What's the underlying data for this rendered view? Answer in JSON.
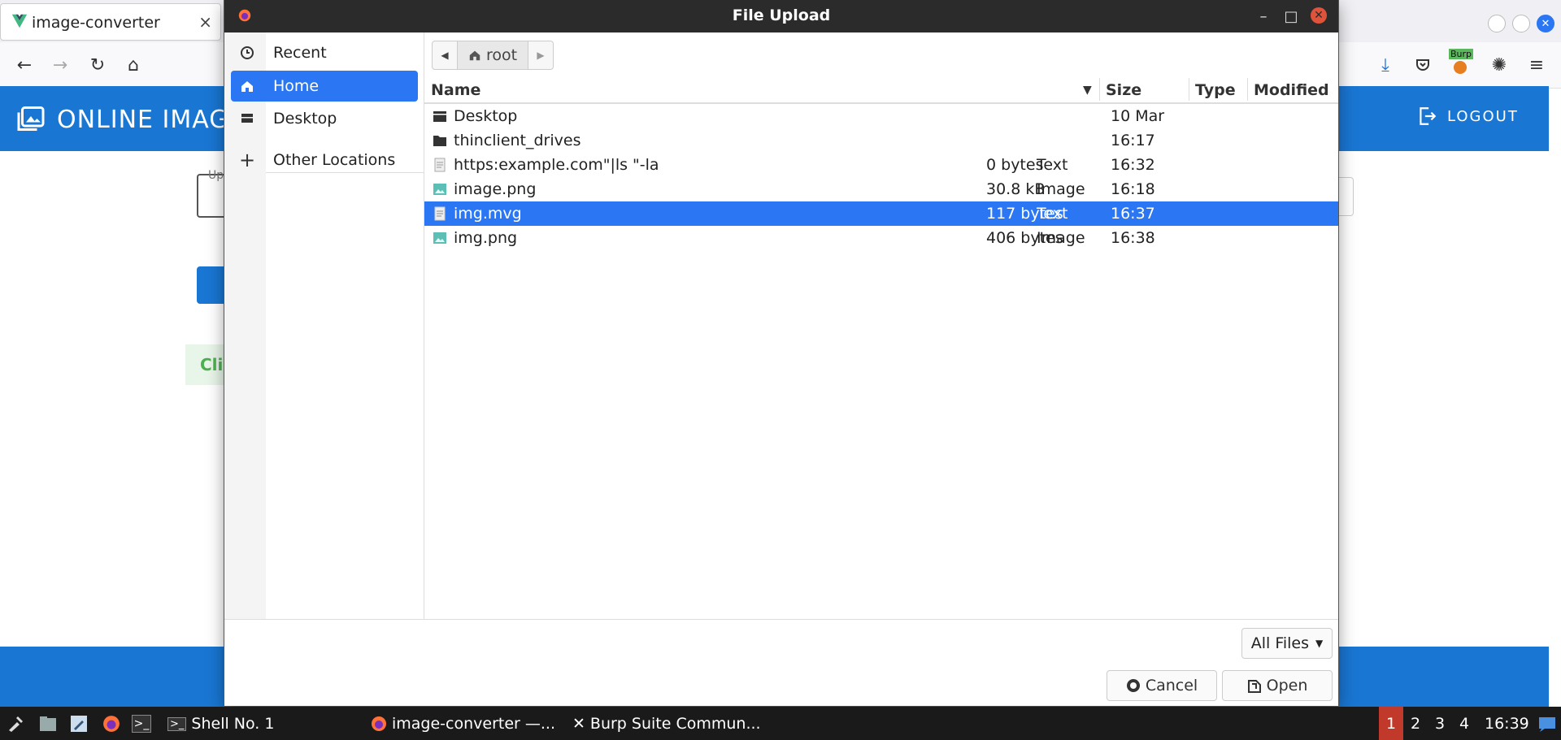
{
  "browser": {
    "tab_title": "image-converter",
    "tab_close": "×",
    "extension_badge": "Burp"
  },
  "app": {
    "title": "ONLINE IMAGE",
    "logout_label": "LOGOUT",
    "upload_label_fragment": "Up",
    "green_text_fragment": "Cli",
    "accent_color": "#1976d2"
  },
  "dialog": {
    "title": "File Upload",
    "sidebar": {
      "items": [
        {
          "label": "Recent",
          "icon": "clock-icon"
        },
        {
          "label": "Home",
          "icon": "home-icon",
          "active": true
        },
        {
          "label": "Desktop",
          "icon": "desktop-icon"
        },
        {
          "label": "Other Locations",
          "icon": "plus-icon"
        }
      ]
    },
    "path": {
      "segment": "root"
    },
    "columns": {
      "name": "Name",
      "size": "Size",
      "type": "Type",
      "modified": "Modified"
    },
    "files": [
      {
        "name": "Desktop",
        "size": "",
        "type": "",
        "modified": "10 Mar",
        "icon": "folder-icon"
      },
      {
        "name": "thinclient_drives",
        "size": "",
        "type": "",
        "modified": "16:17",
        "icon": "folder-icon"
      },
      {
        "name": "https:example.com\"|ls \"-la",
        "size": "0 bytes",
        "type": "Text",
        "modified": "16:32",
        "icon": "text-file-icon"
      },
      {
        "name": "image.png",
        "size": "30.8  kB",
        "type": "Image",
        "modified": "16:18",
        "icon": "image-file-icon"
      },
      {
        "name": "img.mvg",
        "size": "117 bytes",
        "type": "Text",
        "modified": "16:37",
        "icon": "text-file-icon",
        "selected": true
      },
      {
        "name": "img.png",
        "size": "406 bytes",
        "type": "Image",
        "modified": "16:38",
        "icon": "image-file-icon"
      }
    ],
    "filter_label": "All Files",
    "cancel_label": "Cancel",
    "open_label": "Open",
    "selection_color": "#2a76f3"
  },
  "taskbar": {
    "tasks": [
      {
        "label": "Shell No. 1",
        "icon": "terminal-icon"
      },
      {
        "label": "image-converter —...",
        "icon": "firefox-icon"
      },
      {
        "label": "Burp Suite Commun...",
        "icon": "burp-icon"
      }
    ],
    "workspaces": [
      "1",
      "2",
      "3",
      "4"
    ],
    "active_workspace": "1",
    "clock": "16:39"
  }
}
